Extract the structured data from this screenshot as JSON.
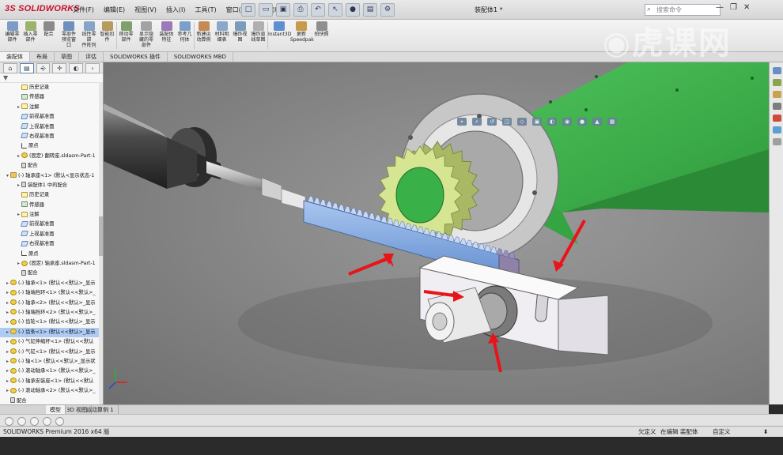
{
  "app": {
    "brand": "SOLIDWORKS",
    "doc_title": "装配体1 *",
    "search_placeholder": "搜索命令"
  },
  "menu": [
    "文件(F)",
    "编辑(E)",
    "视图(V)",
    "插入(I)",
    "工具(T)",
    "窗口(W)",
    "帮助(H)"
  ],
  "toolbar": {
    "items": [
      {
        "label": "编辑零\n部件",
        "color": "#7c9cc7"
      },
      {
        "label": "插入零\n部件",
        "color": "#9bb36a"
      },
      {
        "label": "配合",
        "color": "#8a8a8a"
      },
      {
        "label": "零部件\n预览窗\n口",
        "color": "#6f8fbc"
      },
      {
        "label": "线性零部\n件阵列",
        "color": "#86a3c8"
      },
      {
        "label": "智能扣\n件",
        "color": "#b69b5c"
      },
      {
        "label": "移动零\n部件",
        "color": "#7ea06b"
      },
      {
        "label": "显示隐\n藏的零\n部件",
        "color": "#a3a3a3"
      },
      {
        "label": "装配体\n特征",
        "color": "#9c7ab8"
      },
      {
        "label": "参考几\n何体",
        "color": "#7aa0c8"
      },
      {
        "label": "新建运\n动算例",
        "color": "#c48a54"
      },
      {
        "label": "材料明\n细表",
        "color": "#8aa8c8"
      },
      {
        "label": "爆炸视\n图",
        "color": "#7a9cbc"
      },
      {
        "label": "爆炸直\n线草图",
        "color": "#b0b0b0"
      },
      {
        "label": "Instant3D",
        "color": "#5e8fcf"
      },
      {
        "label": "更新\nSpeedpak",
        "color": "#c89a4a"
      },
      {
        "label": "拍快照",
        "color": "#8e8e8e"
      }
    ]
  },
  "command_tabs": [
    "装配体",
    "布局",
    "草图",
    "评估",
    "SOLIDWORKS 插件",
    "SOLIDWORKS MBD"
  ],
  "feature_tree": [
    {
      "text": "历史记录",
      "icon": "note",
      "level": 1,
      "exp": ""
    },
    {
      "text": "传感器",
      "icon": "sensor",
      "level": 1,
      "exp": ""
    },
    {
      "text": "注解",
      "icon": "note",
      "level": 1,
      "exp": "▸"
    },
    {
      "text": "前视基准面",
      "icon": "plane",
      "level": 1,
      "exp": ""
    },
    {
      "text": "上视基准面",
      "icon": "plane",
      "level": 1,
      "exp": ""
    },
    {
      "text": "右视基准面",
      "icon": "plane",
      "level": 1,
      "exp": ""
    },
    {
      "text": "原点",
      "icon": "origin",
      "level": 1,
      "exp": ""
    },
    {
      "text": "(固定) 翻转座.sldasm-Part-1",
      "icon": "part",
      "level": 1,
      "exp": "▸"
    },
    {
      "text": "配合",
      "icon": "mate",
      "level": 1,
      "exp": ""
    },
    {
      "text": "(-) 轴承座<1> (默认<显示状态-1",
      "icon": "fold",
      "level": 0,
      "exp": "▾"
    },
    {
      "text": "装配体1 中的配合",
      "icon": "mate",
      "level": 1,
      "exp": "▸"
    },
    {
      "text": "历史记录",
      "icon": "note",
      "level": 1,
      "exp": ""
    },
    {
      "text": "传感器",
      "icon": "sensor",
      "level": 1,
      "exp": ""
    },
    {
      "text": "注解",
      "icon": "note",
      "level": 1,
      "exp": "▸"
    },
    {
      "text": "前视基准面",
      "icon": "plane",
      "level": 1,
      "exp": ""
    },
    {
      "text": "上视基准面",
      "icon": "plane",
      "level": 1,
      "exp": ""
    },
    {
      "text": "右视基准面",
      "icon": "plane",
      "level": 1,
      "exp": ""
    },
    {
      "text": "原点",
      "icon": "origin",
      "level": 1,
      "exp": ""
    },
    {
      "text": "(固定) 轴承座.sldasm-Part-1",
      "icon": "part",
      "level": 1,
      "exp": "▸"
    },
    {
      "text": "配合",
      "icon": "mate",
      "level": 1,
      "exp": ""
    },
    {
      "text": "(-) 轴承<1> (默认<<默认>_显示",
      "icon": "part",
      "level": 0,
      "exp": "▸"
    },
    {
      "text": "(-) 轴端挡环<1> (默认<<默认>_",
      "icon": "part",
      "level": 0,
      "exp": "▸"
    },
    {
      "text": "(-) 轴承<2> (默认<<默认>_显示",
      "icon": "part",
      "level": 0,
      "exp": "▸"
    },
    {
      "text": "(-) 轴端挡环<2> (默认<<默认>_",
      "icon": "part",
      "level": 0,
      "exp": "▸"
    },
    {
      "text": "(-) 齿轮<1> (默认<<默认>_显示",
      "icon": "part",
      "level": 0,
      "exp": "▸"
    },
    {
      "text": "(-) 齿条<1> (默认<<默认>_显示",
      "icon": "part",
      "level": 0,
      "exp": "▸",
      "selected": true
    },
    {
      "text": "(-) 气缸伸缩杆<1> (默认<<默认",
      "icon": "part",
      "level": 0,
      "exp": "▸"
    },
    {
      "text": "(-) 气缸<1> (默认<<默认>_显示",
      "icon": "part",
      "level": 0,
      "exp": "▸"
    },
    {
      "text": "(-) 轴<1> (默认<<默认>_显示状",
      "icon": "part",
      "level": 0,
      "exp": "▸"
    },
    {
      "text": "(-) 滚动轴承<1> (默认<<默认>_",
      "icon": "part",
      "level": 0,
      "exp": "▸"
    },
    {
      "text": "(-) 轴承安装座<1> (默认<<默认",
      "icon": "part",
      "level": 0,
      "exp": "▸"
    },
    {
      "text": "(-) 滚动轴承<2> (默认<<默认>_",
      "icon": "part",
      "level": 0,
      "exp": "▸"
    },
    {
      "text": "配合",
      "icon": "mate",
      "level": 0,
      "exp": ""
    }
  ],
  "bottom_tabs": [
    "模型",
    "3D 视图",
    "运动算例 1"
  ],
  "status": {
    "product": "SOLIDWORKS Premium 2016 x64 版",
    "state": "欠定义",
    "mode": "在编辑 装配体",
    "custom": "自定义"
  },
  "watermark": "虎课网",
  "colors": {
    "housing": "#3bb34a",
    "rack": "#7fa7de",
    "gear": "#d6e592",
    "arrow": "#e8141a",
    "selection": "#aecbf3"
  }
}
